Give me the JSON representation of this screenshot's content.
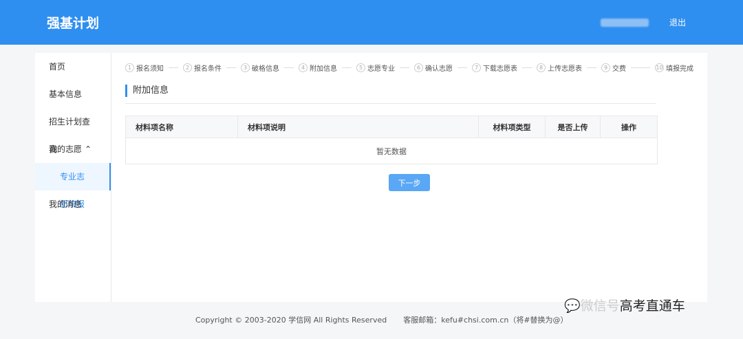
{
  "header": {
    "title": "强基计划",
    "logout": "退出"
  },
  "sidebar": {
    "items": [
      {
        "label": "首页"
      },
      {
        "label": "基本信息"
      },
      {
        "label": "招生计划查询"
      },
      {
        "label": "我的志愿"
      },
      {
        "label": "专业志愿填报"
      },
      {
        "label": "我的消息"
      }
    ]
  },
  "steps": [
    {
      "n": "1",
      "label": "报名须知"
    },
    {
      "n": "2",
      "label": "报名条件"
    },
    {
      "n": "3",
      "label": "破格信息"
    },
    {
      "n": "4",
      "label": "附加信息"
    },
    {
      "n": "5",
      "label": "志愿专业"
    },
    {
      "n": "6",
      "label": "确认志愿"
    },
    {
      "n": "7",
      "label": "下载志愿表"
    },
    {
      "n": "8",
      "label": "上传志愿表"
    },
    {
      "n": "9",
      "label": "交费"
    },
    {
      "n": "10",
      "label": "填报完成"
    }
  ],
  "section_title": "附加信息",
  "table": {
    "columns": [
      "材料项名称",
      "材料项说明",
      "材料项类型",
      "是否上传",
      "操作"
    ],
    "empty": "暂无数据"
  },
  "next_button": "下一步",
  "footer": {
    "copyright": "Copyright © 2003-2020 学信网 All Rights Reserved",
    "email": "客服邮箱：kefu#chsi.com.cn（将#替换为@）"
  },
  "watermark": {
    "prefix": "微信号",
    "name": "高考直通车"
  }
}
